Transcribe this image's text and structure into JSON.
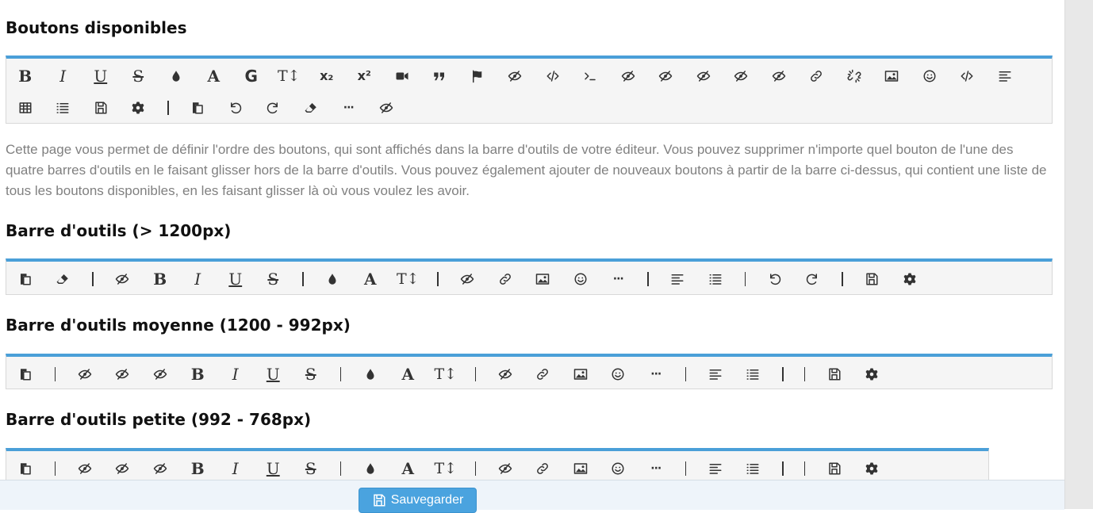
{
  "sections": {
    "available_title": "Boutons disponibles",
    "large_title": "Barre d'outils (> 1200px)",
    "medium_title": "Barre d'outils moyenne (1200 - 992px)",
    "small_title": "Barre d'outils petite (992 - 768px)"
  },
  "description": "Cette page vous permet de définir l'ordre des boutons, qui sont affichés dans la barre d'outils de votre éditeur. Vous pouvez supprimer n'importe quel bouton de l'une des quatre barres d'outils en le faisant glisser hors de la barre d'outils. Vous pouvez également ajouter de nouveaux boutons à partir de la barre ci-dessus, qui contient une liste de tous les boutons disponibles, en les faisant glisser là où vous voulez les avoir.",
  "labels": {
    "bold": "B",
    "italic": "I",
    "underline": "U",
    "strike": "S",
    "font": "A",
    "google_font": "G",
    "font_size": "T↕",
    "subscript": "x₂",
    "superscript": "x²",
    "ellipsis": "···"
  },
  "toolbars": {
    "available": [
      [
        "bold",
        "italic",
        "underline",
        "strike",
        "color",
        "font",
        "google_font",
        "font_size",
        "subscript",
        "superscript",
        "video",
        "quote",
        "flag",
        "hidden",
        "code",
        "terminal",
        "hidden",
        "hidden",
        "hidden",
        "hidden",
        "hidden",
        "link",
        "unlink",
        "image",
        "emoji",
        "code",
        "align",
        "table",
        "list",
        "save",
        "settings",
        "|",
        "paste",
        "undo",
        "redo",
        "eraser",
        "ellipsis",
        "hidden"
      ]
    ],
    "large": [
      "paste",
      "eraser",
      "|",
      "hidden",
      "bold",
      "italic",
      "underline",
      "strike",
      "|",
      "color",
      "font",
      "font_size",
      "|",
      "hidden",
      "link",
      "image",
      "emoji",
      "ellipsis",
      "|",
      "align",
      "list",
      "|",
      "undo",
      "redo",
      "|",
      "save",
      "settings"
    ],
    "medium": [
      "paste",
      "|",
      "hidden",
      "hidden",
      "hidden",
      "bold",
      "italic",
      "underline",
      "strike",
      "|",
      "color",
      "font",
      "font_size",
      "|",
      "hidden",
      "link",
      "image",
      "emoji",
      "ellipsis",
      "|",
      "align",
      "list",
      "|",
      "|",
      "save",
      "settings"
    ],
    "small": [
      "paste",
      "|",
      "hidden",
      "hidden",
      "hidden",
      "bold",
      "italic",
      "underline",
      "strike",
      "|",
      "color",
      "font",
      "font_size",
      "|",
      "hidden",
      "link",
      "image",
      "emoji",
      "ellipsis",
      "|",
      "align",
      "list",
      "|",
      "|",
      "save",
      "settings"
    ]
  },
  "icons": {
    "color": "droplet-icon",
    "video": "video-camera-icon",
    "quote": "quote-icon",
    "flag": "flag-icon",
    "hidden": "eye-slash-icon",
    "code": "code-icon",
    "terminal": "terminal-icon",
    "link": "link-icon",
    "unlink": "unlink-icon",
    "image": "image-icon",
    "emoji": "smiley-icon",
    "align": "align-left-icon",
    "table": "table-icon",
    "list": "list-icon",
    "save": "floppy-disk-icon",
    "settings": "gear-icon",
    "paste": "paste-icon",
    "undo": "undo-icon",
    "redo": "redo-icon",
    "eraser": "eraser-icon"
  },
  "footer": {
    "save_label": "Sauvegarder"
  },
  "colors": {
    "accent": "#4a9fd8",
    "button": "#4aa3df",
    "text_muted": "#808080"
  }
}
